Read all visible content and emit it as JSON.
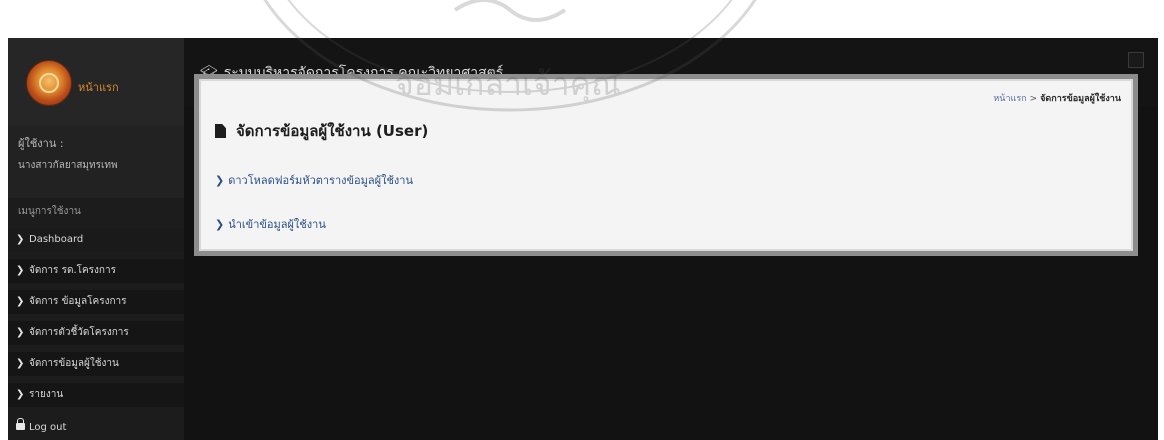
{
  "sidebar": {
    "home_label": "หน้าแรก",
    "user_label": "ผู้ใช้งาน :",
    "user_name": "นางสาวกัลยาสมุทรเทพ",
    "menu_heading": "เมนูการใช้งาน",
    "items": [
      {
        "label": "Dashboard"
      },
      {
        "label": "จัดการ รด.โครงการ"
      },
      {
        "label": "จัดการ ข้อมูลโครงการ"
      },
      {
        "label": "จัดการตัวชี้วัดโครงการ"
      },
      {
        "label": "จัดการข้อมูลผู้ใช้งาน"
      },
      {
        "label": "รายงาน"
      }
    ],
    "logout_label": "Log out"
  },
  "header": {
    "title": "ระบบบริหารจัดการโครงการ คณะวิทยาศาสตร์"
  },
  "breadcrumb": {
    "home": "หน้าแรก",
    "separator": ">",
    "current": "จัดการข้อมูลผู้ใช้งาน"
  },
  "main": {
    "page_title": "จัดการข้อมูลผู้ใช้งาน (User)",
    "actions": [
      {
        "label": "ดาวโหลดฟอร์มหัวตารางข้อมูลผู้ใช้งาน"
      },
      {
        "label": "นำเข้าข้อมูลผู้ใช้งาน"
      }
    ]
  },
  "watermark": {
    "text": "จอมเกล้าเจ้าคุณ"
  },
  "colors": {
    "frame_bg": "#121212",
    "sidebar_bg": "#1c1c1c",
    "link_blue": "#2a4f86",
    "home_orange": "#d98a2f"
  },
  "icons": [
    "university-logo-icon",
    "graduation-cap-icon",
    "chevron-right-icon",
    "document-icon",
    "lock-icon"
  ]
}
